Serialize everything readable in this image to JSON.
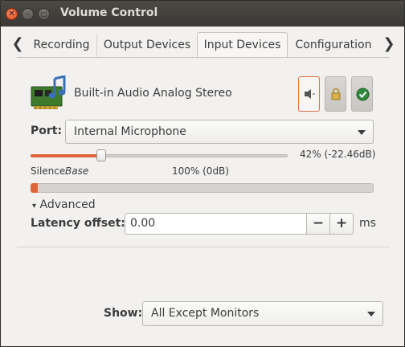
{
  "window": {
    "title": "Volume Control"
  },
  "tabs": {
    "prev_arrow": "❮",
    "next_arrow": "❯",
    "items": [
      {
        "label": "Recording",
        "active": false
      },
      {
        "label": "Output Devices",
        "active": false
      },
      {
        "label": "Input Devices",
        "active": true
      },
      {
        "label": "Configuration",
        "active": false
      }
    ]
  },
  "device": {
    "name": "Built-in Audio Analog Stereo",
    "icon": "sound-card-icon",
    "toggles": [
      {
        "name": "mute-toggle",
        "icon": "speaker-icon",
        "active": true
      },
      {
        "name": "lock-channels-toggle",
        "icon": "lock-icon",
        "active": false
      },
      {
        "name": "set-default-toggle",
        "icon": "checkmark-icon",
        "active": false
      }
    ]
  },
  "port": {
    "label": "Port:",
    "value": "Internal Microphone"
  },
  "volume": {
    "percent": 42,
    "readout": "42% (-22.46dB)",
    "silence_label": "Silence",
    "base_label": "Base",
    "hundred_label": "100% (0dB)",
    "level_meter": 0.02
  },
  "advanced": {
    "expander_arrow": "▾",
    "label": "Advanced"
  },
  "latency": {
    "label": "Latency offset:",
    "value": "0.00",
    "minus": "−",
    "plus": "+",
    "unit": "ms"
  },
  "show": {
    "label": "Show:",
    "value": "All Except Monitors"
  },
  "colors": {
    "accent": "#e0643a",
    "titlebar": "#3c3b37",
    "background": "#f2f1f0"
  }
}
